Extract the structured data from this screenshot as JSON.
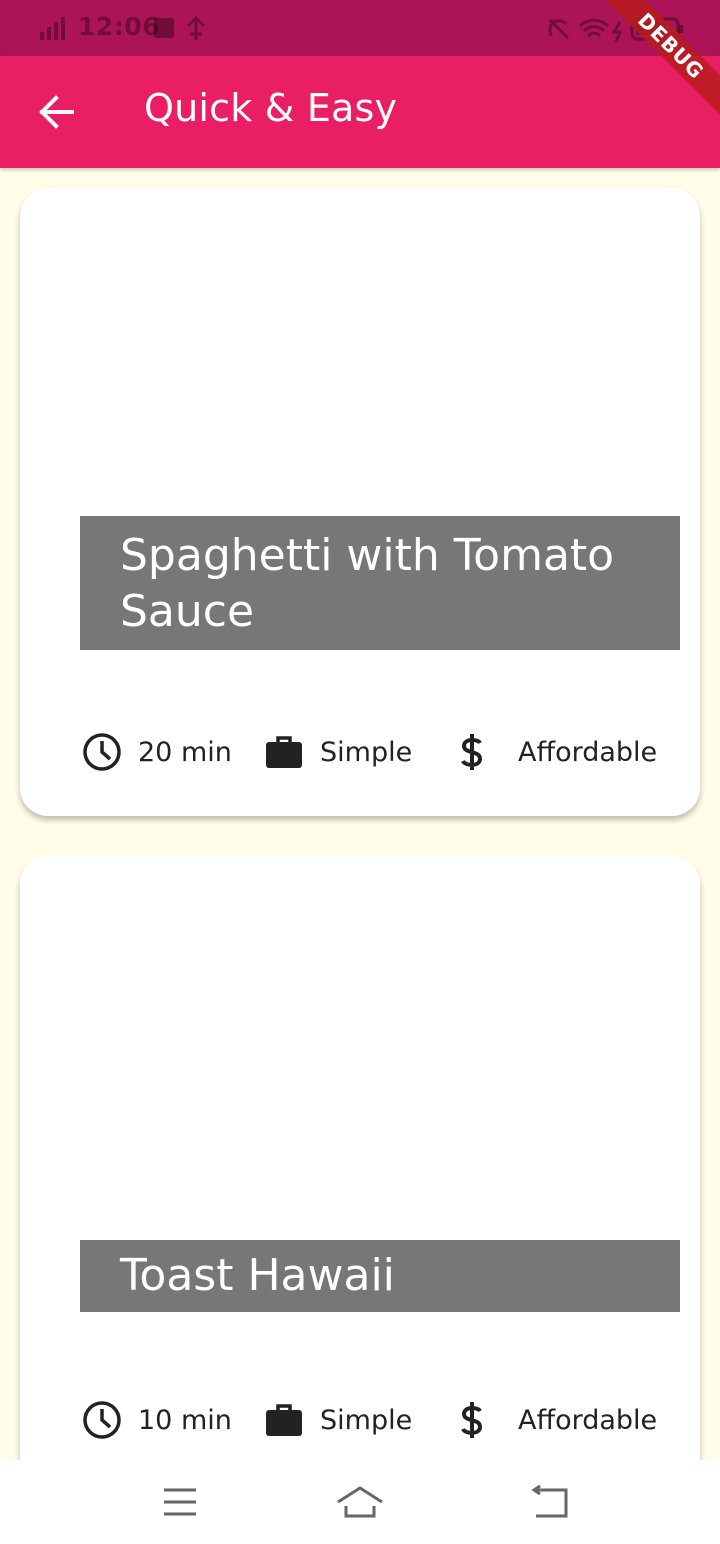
{
  "status_bar": {
    "time": "12:06",
    "icons": [
      "signal-icon",
      "notification-icon",
      "usb-icon",
      "mute-icon",
      "wifi-icon",
      "battery-icon"
    ]
  },
  "debug_banner": {
    "label": "DEBUG"
  },
  "app_bar": {
    "title": "Quick & Easy",
    "back_icon": "arrow-left-icon",
    "color": "#e91e63"
  },
  "meals": [
    {
      "title": "Spaghetti with Tomato Sauce",
      "duration": "20 min",
      "complexity": "Simple",
      "affordability": "Affordable"
    },
    {
      "title": "Toast Hawaii",
      "duration": "10 min",
      "complexity": "Simple",
      "affordability": "Affordable"
    }
  ],
  "nav_bar": {
    "buttons": [
      "menu-icon",
      "home-icon",
      "back-icon"
    ]
  },
  "colors": {
    "primary": "#e91e63",
    "status_bar": "#ad1457",
    "background": "#fffde7",
    "title_overlay": "#777777"
  }
}
